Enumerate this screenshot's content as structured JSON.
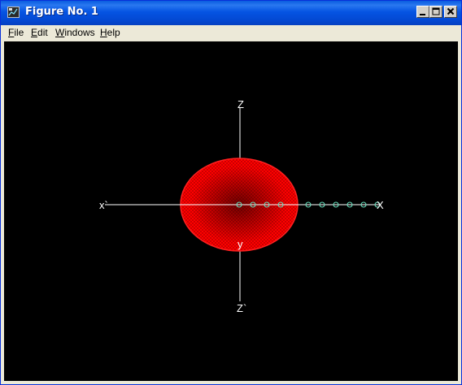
{
  "window": {
    "title": "Figure No. 1",
    "icon": "figure-app-icon",
    "buttons": [
      "minimize-icon",
      "maximize-icon",
      "close-icon"
    ]
  },
  "menu": {
    "file": {
      "label": "File",
      "mnemonic": "F",
      "rest": "ile"
    },
    "edit": {
      "label": "Edit",
      "mnemonic": "E",
      "rest": "dit"
    },
    "windows": {
      "label": "Windows",
      "mnemonic": "W",
      "rest": "indows"
    },
    "help": {
      "label": "Help",
      "mnemonic": "H",
      "rest": "elp"
    }
  },
  "plot": {
    "background": "#000000",
    "axis_color": "#ffffff",
    "surface_color": "#ff0000",
    "marker_color": "#66ddbb",
    "labels": {
      "z_top": "Z",
      "z_bottom": "Z`",
      "x_left": "x`",
      "x_right": "X",
      "y": "y"
    }
  }
}
